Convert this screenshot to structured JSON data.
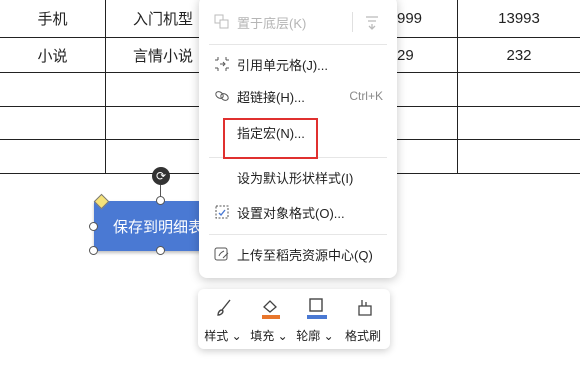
{
  "sheet": {
    "rows": [
      [
        "手机",
        "入门机型",
        "",
        "999",
        "13993"
      ],
      [
        "小说",
        "言情小说",
        "",
        "29",
        "232"
      ],
      [
        "",
        "",
        "",
        "",
        ""
      ],
      [
        "",
        "",
        "",
        "",
        ""
      ],
      [
        "",
        "",
        "",
        "",
        ""
      ]
    ]
  },
  "shape": {
    "text": "保存到明细表"
  },
  "menu": {
    "items": [
      {
        "label": "置于底层(K)",
        "icon": "send-to-back-icon",
        "disabled": true
      },
      {
        "label": "引用单元格(J)...",
        "icon": "cell-reference-icon"
      },
      {
        "label": "超链接(H)...",
        "icon": "link-icon",
        "shortcut": "Ctrl+K"
      },
      {
        "label": "指定宏(N)...",
        "icon": ""
      },
      {
        "label": "设为默认形状样式(I)",
        "icon": ""
      },
      {
        "label": "设置对象格式(O)...",
        "icon": "format-object-icon"
      },
      {
        "label": "上传至稻壳资源中心(Q)",
        "icon": "upload-icon"
      }
    ]
  },
  "toolbar": {
    "items": [
      {
        "label": "样式",
        "icon": "brush-icon"
      },
      {
        "label": "填充",
        "icon": "fill-bucket-icon"
      },
      {
        "label": "轮廓",
        "icon": "outline-icon"
      },
      {
        "label": "格式刷",
        "icon": "format-painter-icon"
      }
    ],
    "colors": {
      "fill": "#e8762c",
      "outline": "#4a79d3"
    }
  },
  "colors": {
    "highlight": "#e0302f",
    "shape": "#4a79d3"
  }
}
